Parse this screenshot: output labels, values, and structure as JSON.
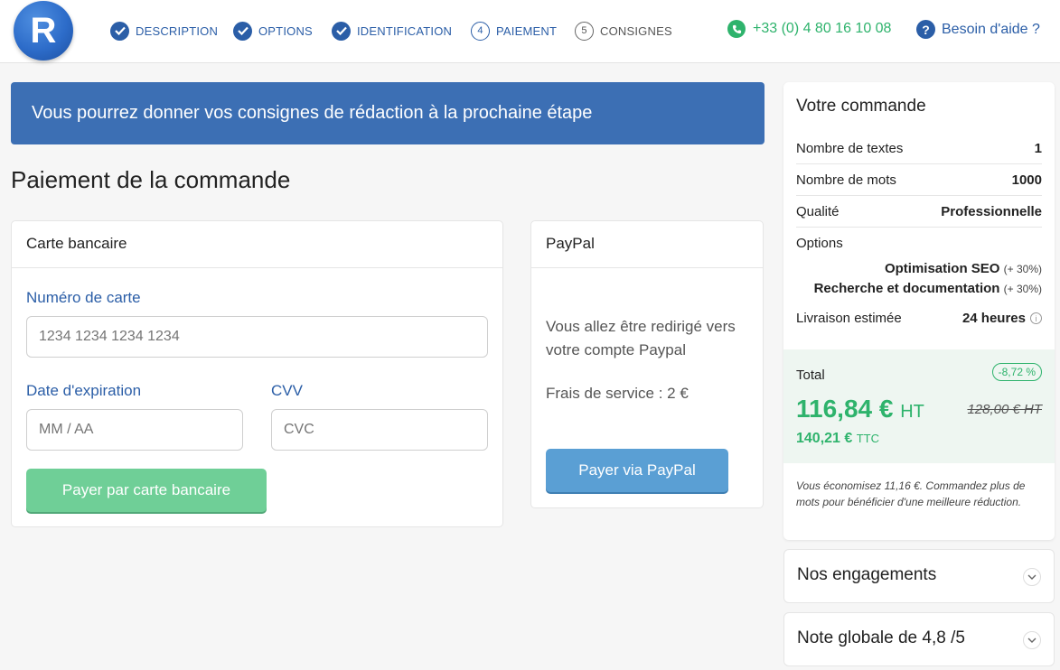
{
  "header": {
    "logo_letter": "R",
    "steps": [
      {
        "label": "DESCRIPTION",
        "done": true
      },
      {
        "label": "OPTIONS",
        "done": true
      },
      {
        "label": "IDENTIFICATION",
        "done": true
      },
      {
        "label": "PAIEMENT",
        "number": "4",
        "done": false
      },
      {
        "label": "CONSIGNES",
        "number": "5",
        "done": false
      }
    ],
    "phone": "+33 (0) 4 80 16 10 08",
    "help": "Besoin d'aide ?"
  },
  "banner": "Vous pourrez donner vos consignes de rédaction à la prochaine étape",
  "page_title": "Paiement de la commande",
  "card": {
    "title": "Carte bancaire",
    "number_label": "Numéro de carte",
    "number_placeholder": "1234 1234 1234 1234",
    "expiry_label": "Date d'expiration",
    "expiry_placeholder": "MM / AA",
    "cvv_label": "CVV",
    "cvv_placeholder": "CVC",
    "pay_button": "Payer par carte bancaire"
  },
  "paypal": {
    "title": "PayPal",
    "redirect_text": "Vous allez être redirigé vers votre compte Paypal",
    "fee_text": "Frais de service : 2 €",
    "pay_button": "Payer via PayPal"
  },
  "order": {
    "title": "Votre commande",
    "rows": [
      {
        "label": "Nombre de textes",
        "value": "1"
      },
      {
        "label": "Nombre de mots",
        "value": "1000"
      },
      {
        "label": "Qualité",
        "value": "Professionnelle"
      }
    ],
    "options_label": "Options",
    "options": [
      {
        "name": "Optimisation SEO",
        "extra": "(+ 30%)"
      },
      {
        "name": "Recherche et documentation",
        "extra": "(+ 30%)"
      }
    ],
    "delivery_label": "Livraison estimée",
    "delivery_value": "24 heures",
    "total_label": "Total",
    "discount": "-8,72 %",
    "price_ht": "116,84 €",
    "price_ht_suffix": "HT",
    "price_old": "128,00 € HT",
    "price_ttc": "140,21 €",
    "price_ttc_suffix": "TTC",
    "savings": "Vous économisez 11,16 €. Commandez plus de mots pour bénéficier d'une meilleure réduction."
  },
  "accordions": [
    {
      "title": "Nos engagements"
    },
    {
      "title": "Note globale de 4,8 /5"
    }
  ],
  "colors": {
    "primary": "#2b5ea7",
    "banner": "#3c6fb4",
    "green": "#2eb36c",
    "card_button": "#6fcf97",
    "paypal_button": "#5a9fd4"
  }
}
